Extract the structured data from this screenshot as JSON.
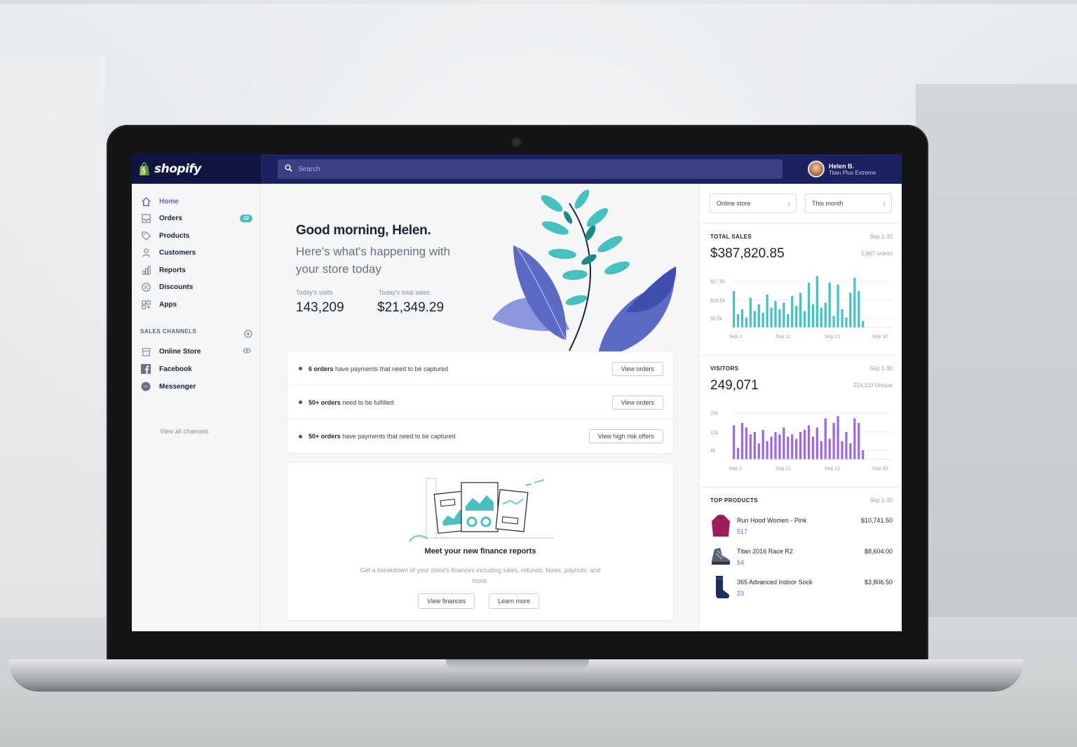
{
  "app": {
    "brand": "shopify",
    "search_placeholder": "Search",
    "user_name": "Helen B.",
    "user_store": "Titan Plus Extreme"
  },
  "sidebar": {
    "items": [
      {
        "label": "Home",
        "icon": "home-icon",
        "active": true
      },
      {
        "label": "Orders",
        "icon": "orders-icon",
        "badge": "12"
      },
      {
        "label": "Products",
        "icon": "tag-icon"
      },
      {
        "label": "Customers",
        "icon": "person-icon"
      },
      {
        "label": "Reports",
        "icon": "bar-chart-icon"
      },
      {
        "label": "Discounts",
        "icon": "discount-icon"
      },
      {
        "label": "Apps",
        "icon": "apps-icon"
      }
    ],
    "section_label": "SALES CHANNELS",
    "channels": [
      {
        "label": "Online Store",
        "icon": "store-icon"
      },
      {
        "label": "Facebook",
        "icon": "facebook-icon"
      },
      {
        "label": "Messenger",
        "icon": "messenger-icon"
      }
    ],
    "view_all": "View all channels"
  },
  "main": {
    "greeting": "Good morning, Helen.",
    "subgreeting": "Here's what's happening with your store today",
    "visits_label": "Today's visits",
    "visits_value": "143,209",
    "sales_label": "Today's total sales",
    "sales_value": "$21,349.29",
    "tasks": [
      {
        "bold": "6 orders",
        "text": " have payments that need to be captured",
        "button": "View orders"
      },
      {
        "bold": "50+ orders",
        "text": " need to be fulfilled",
        "button": "View orders"
      },
      {
        "bold": "50+ orders",
        "text": " have payments that need to be captured",
        "button": "View high risk offers"
      }
    ],
    "finance_title": "Meet your new finance reports",
    "finance_desc": "Get a breakdown of your store's finances including sales, refunds, taxes, payouts, and more.",
    "finance_btn1": "View finances",
    "finance_btn2": "Learn more"
  },
  "right": {
    "channel_select": "Online store",
    "period_select": "This month",
    "sales": {
      "title": "TOTAL SALES",
      "range": "Sep 1-30",
      "value": "$387,820.85",
      "sub": "5,667 orders"
    },
    "visitors": {
      "title": "VISITORS",
      "range": "Sep 1-30",
      "value": "249,071",
      "sub": "216,110 Unique"
    },
    "top_products": {
      "title": "TOP PRODUCTS",
      "range": "Sep 1-30",
      "items": [
        {
          "name": "Run Hood Women - Pink",
          "qty": "517",
          "price": "$10,741.50"
        },
        {
          "name": "Titan 2016 Race R2",
          "qty": "54",
          "price": "$8,604.00"
        },
        {
          "name": "365 Advanced Indoor Sock",
          "qty": "23",
          "price": "$3,806.50"
        }
      ]
    }
  },
  "colors": {
    "topbar": "#1c2260",
    "brand_bg": "#0f1443",
    "accent": "#5c6ac4",
    "teal": "#47c1bf",
    "purple": "#9c6ade"
  },
  "chart_data": [
    {
      "type": "bar",
      "title": "TOTAL SALES",
      "y_ticks": [
        "$27.5k",
        "$16.5k",
        "$5.5k"
      ],
      "x_ticks": [
        "Sep 1",
        "Sep 11",
        "Sep 21",
        "Sep 30"
      ],
      "ylim": [
        0,
        33
      ],
      "values": [
        22,
        8,
        11,
        6,
        18,
        10,
        14,
        9,
        20,
        12,
        16,
        11,
        15,
        8,
        19,
        13,
        21,
        10,
        27,
        14,
        31,
        12,
        15,
        27,
        7,
        26,
        11,
        6,
        21,
        30,
        22,
        4
      ]
    },
    {
      "type": "bar",
      "title": "VISITORS",
      "y_ticks": [
        "20k",
        "12k",
        "4k"
      ],
      "x_ticks": [
        "Sep 1",
        "Sep 11",
        "Sep 21",
        "Sep 30"
      ],
      "ylim": [
        0,
        24
      ],
      "values": [
        15,
        5,
        16,
        14,
        11,
        12,
        7,
        13,
        8,
        10,
        12,
        11,
        14,
        10,
        11,
        9,
        12,
        13,
        15,
        10,
        14,
        8,
        18,
        9,
        16,
        19,
        8,
        12,
        7,
        18,
        16,
        4
      ]
    }
  ]
}
